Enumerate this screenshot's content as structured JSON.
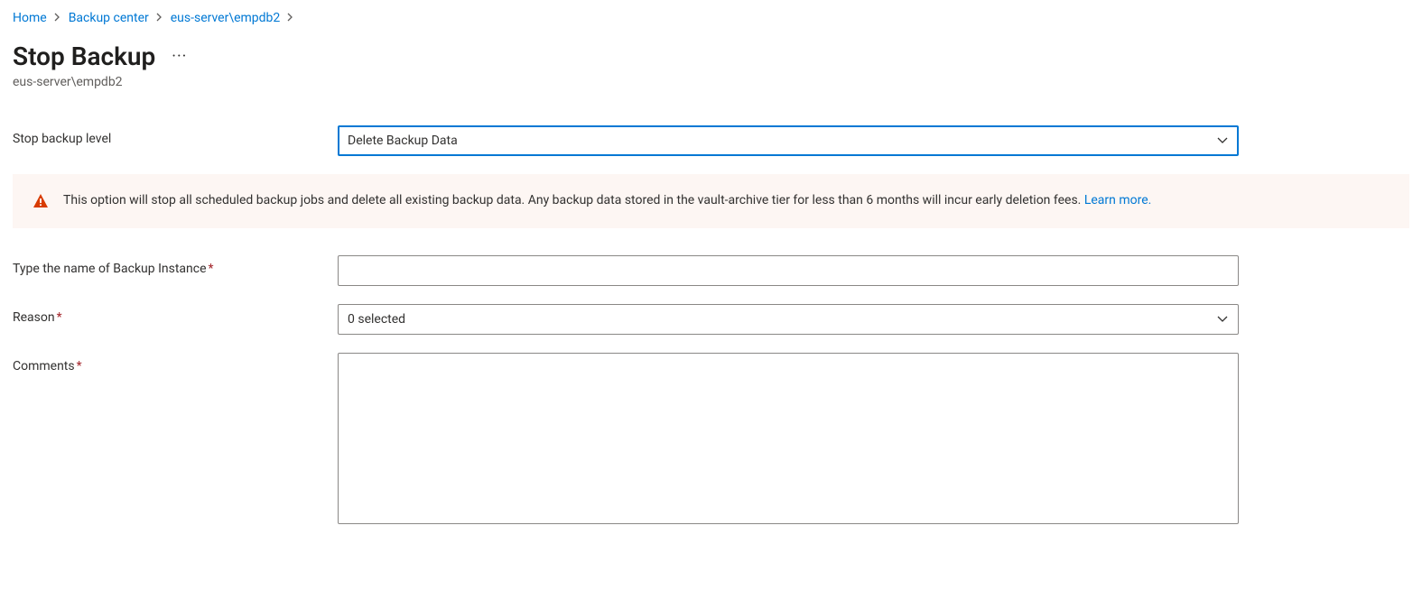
{
  "breadcrumb": {
    "items": [
      {
        "label": "Home"
      },
      {
        "label": "Backup center"
      },
      {
        "label": "eus-server\\empdb2"
      }
    ]
  },
  "header": {
    "title": "Stop Backup",
    "subtitle": "eus-server\\empdb2"
  },
  "form": {
    "stopLevel": {
      "label": "Stop backup level",
      "value": "Delete Backup Data"
    },
    "warning": {
      "text": "This option will stop all scheduled backup jobs and delete all existing backup data. Any backup data stored in the vault-archive tier for less than 6 months will incur early deletion fees. ",
      "learnMore": "Learn more."
    },
    "instanceName": {
      "label": "Type the name of Backup Instance",
      "value": ""
    },
    "reason": {
      "label": "Reason",
      "value": "0 selected"
    },
    "comments": {
      "label": "Comments",
      "value": ""
    }
  }
}
